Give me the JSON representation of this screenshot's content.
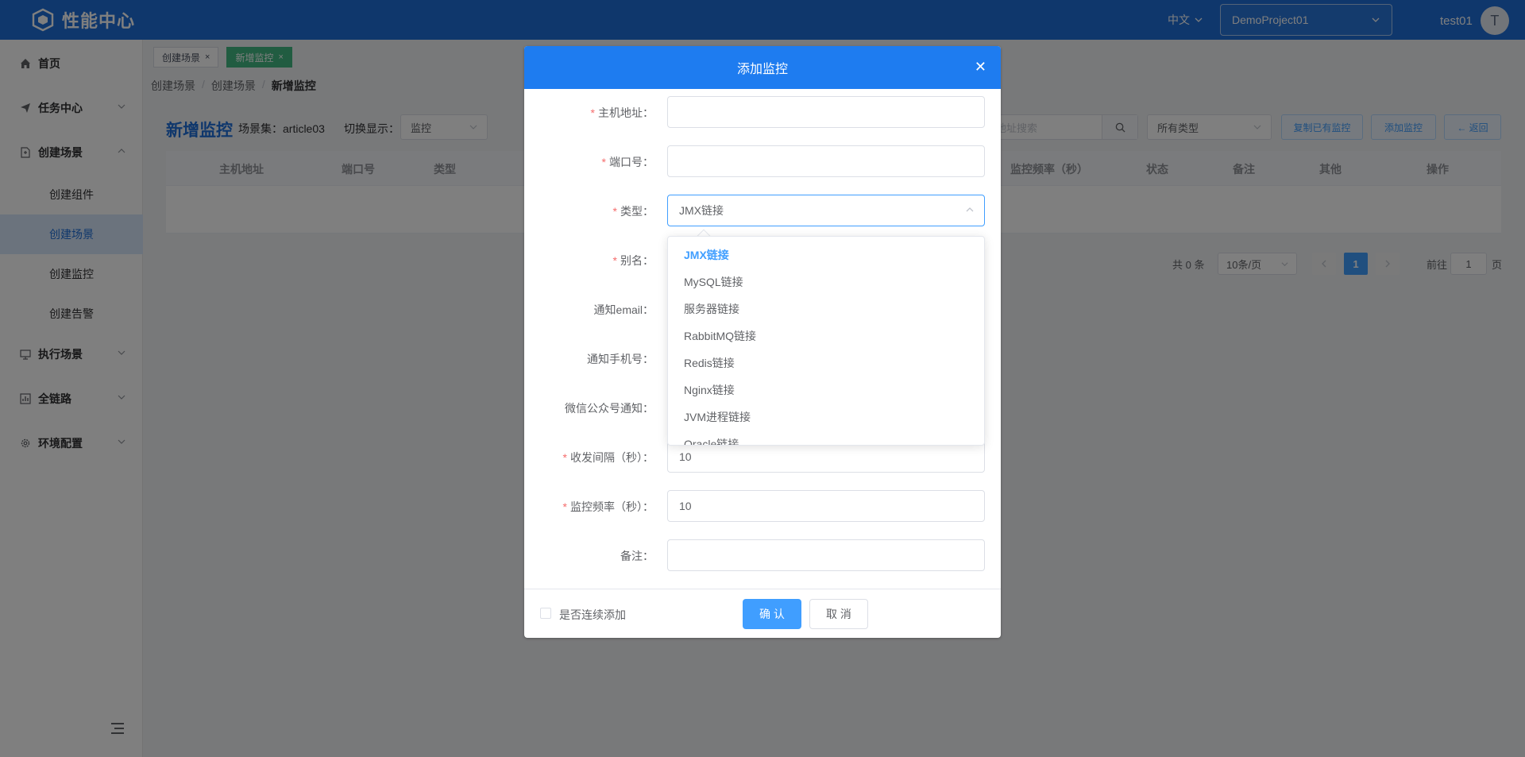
{
  "header": {
    "title": "性能中心",
    "language": "中文",
    "project": "DemoProject01",
    "username": "test01",
    "avatar_letter": "T"
  },
  "sidebar": {
    "items": [
      {
        "label": "首页",
        "icon": "home-icon"
      },
      {
        "label": "任务中心",
        "icon": "send-icon"
      },
      {
        "label": "创建场景",
        "icon": "document-icon"
      },
      {
        "label": "执行场景",
        "icon": "monitor-icon"
      },
      {
        "label": "全链路",
        "icon": "chart-icon"
      },
      {
        "label": "环境配置",
        "icon": "gear-icon"
      }
    ],
    "sub_items": [
      "创建组件",
      "创建场景",
      "创建监控",
      "创建告警"
    ]
  },
  "tags": [
    {
      "label": "创建场景",
      "active": false
    },
    {
      "label": "新增监控",
      "active": true
    }
  ],
  "breadcrumb": [
    "创建场景",
    "创建场景",
    "新增监控"
  ],
  "page": {
    "title": "新增监控",
    "scene_label": "场景集：article03",
    "switch_label": "切换显示：",
    "switch_value": "监控",
    "search_placeholder": "机地址搜索",
    "type_filter": "所有类型",
    "btn_copy": "复制已有监控",
    "btn_add": "添加监控",
    "btn_back": "← 返回"
  },
  "table": {
    "columns": [
      "主机地址",
      "端口号",
      "类型",
      "监控频率（秒）",
      "状态",
      "备注",
      "其他",
      "操作"
    ]
  },
  "pagination": {
    "total": "共 0 条",
    "page_size": "10条/页",
    "current": "1",
    "goto_prefix": "前往",
    "goto_value": "1",
    "goto_suffix": "页"
  },
  "dialog": {
    "title": "添加监控",
    "fields": [
      {
        "label": "主机地址：",
        "required": true,
        "value": ""
      },
      {
        "label": "端口号：",
        "required": true,
        "value": ""
      },
      {
        "label": "类型：",
        "required": true,
        "value": "JMX链接"
      },
      {
        "label": "别名：",
        "required": true,
        "value": ""
      },
      {
        "label": "通知email：",
        "required": false,
        "value": ""
      },
      {
        "label": "通知手机号：",
        "required": false,
        "value": ""
      },
      {
        "label": "微信公众号通知：",
        "required": false,
        "value": ""
      },
      {
        "label": "收发间隔（秒）：",
        "required": true,
        "value": "10"
      },
      {
        "label": "监控频率（秒）：",
        "required": true,
        "value": "10"
      },
      {
        "label": "备注：",
        "required": false,
        "value": ""
      }
    ],
    "continuous_label": "是否连续添加",
    "confirm": "确 认",
    "cancel": "取 消"
  },
  "type_dropdown": {
    "options": [
      "JMX链接",
      "MySQL链接",
      "服务器链接",
      "RabbitMQ链接",
      "Redis链接",
      "Nginx链接",
      "JVM进程链接",
      "Oracle链接"
    ],
    "selected": "JMX链接"
  },
  "colors": {
    "header_bg": "#1e6fd9",
    "dialog_header": "#1e7cf0",
    "primary": "#409eff",
    "required": "#f56c6c"
  }
}
